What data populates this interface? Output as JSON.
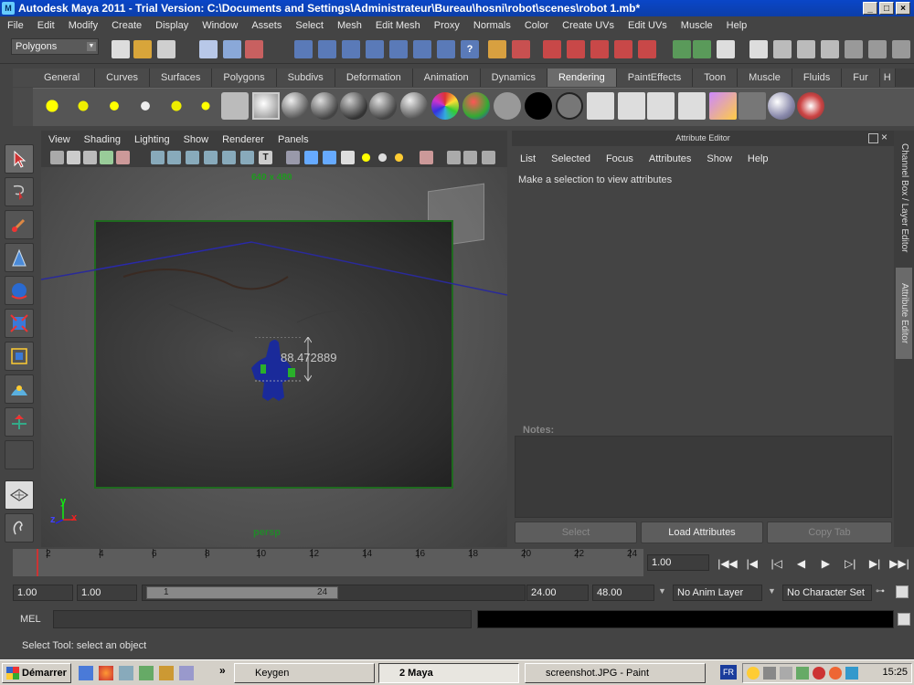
{
  "window": {
    "title": "Autodesk Maya 2011 - Trial Version: C:\\Documents and Settings\\Administrateur\\Bureau\\hosni\\robot\\scenes\\robot 1.mb*"
  },
  "menubar": [
    "File",
    "Edit",
    "Modify",
    "Create",
    "Display",
    "Window",
    "Assets",
    "Select",
    "Mesh",
    "Edit Mesh",
    "Proxy",
    "Normals",
    "Color",
    "Create UVs",
    "Edit UVs",
    "Muscle",
    "Help"
  ],
  "toolbar": {
    "mode": "Polygons"
  },
  "shelf_tabs": [
    "General",
    "Curves",
    "Surfaces",
    "Polygons",
    "Subdivs",
    "Deformation",
    "Animation",
    "Dynamics",
    "Rendering",
    "PaintEffects",
    "Toon",
    "Muscle",
    "Fluids",
    "Fur",
    "H"
  ],
  "active_shelf_tab": "Rendering",
  "viewport": {
    "menu": [
      "View",
      "Shading",
      "Lighting",
      "Show",
      "Renderer",
      "Panels"
    ],
    "resolution": "640 x 480",
    "camera": "persp",
    "measure": "88.472889",
    "axis_x": "x",
    "axis_y": "y",
    "axis_z": "z"
  },
  "attribute_editor": {
    "title": "Attribute Editor",
    "menu": [
      "List",
      "Selected",
      "Focus",
      "Attributes",
      "Show",
      "Help"
    ],
    "message": "Make a selection to view attributes",
    "notes_label": "Notes:",
    "btn_select": "Select",
    "btn_load": "Load Attributes",
    "btn_copy": "Copy Tab"
  },
  "side_tabs": {
    "channel_box": "Channel Box / Layer Editor",
    "attribute_editor": "Attribute Editor"
  },
  "timeline": {
    "ticks": [
      "2",
      "4",
      "6",
      "8",
      "10",
      "12",
      "14",
      "16",
      "18",
      "20",
      "22",
      "24"
    ],
    "current_frame": "1.00"
  },
  "range": {
    "start": "1.00",
    "anim_start": "1.00",
    "slider_start": "1",
    "slider_end": "24",
    "end": "24.00",
    "anim_end": "48.00",
    "anim_layer": "No Anim Layer",
    "char_set": "No Character Set"
  },
  "command": {
    "label": "MEL",
    "help": "Select Tool: select an object"
  },
  "taskbar": {
    "start": "Démarrer",
    "tasks": [
      "Keygen",
      "2 Maya",
      "screenshot.JPG - Paint"
    ],
    "lang": "FR",
    "clock": "15:25"
  },
  "colors": {
    "title_blue": "#0a46c8",
    "maya_bg": "#444444",
    "cam_green": "#1f6a1f",
    "robot_blue": "#1a2a9a"
  }
}
